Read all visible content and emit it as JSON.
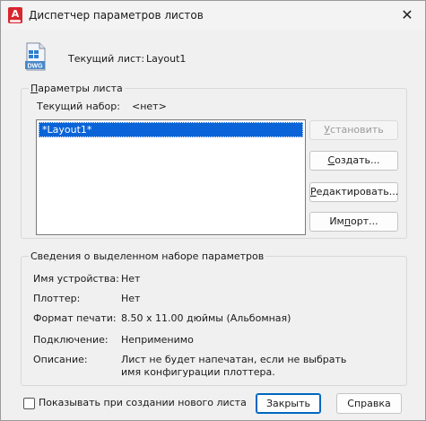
{
  "window": {
    "title": "Диспетчер параметров листов",
    "app_icon": "autocad-icon",
    "app_icon_letter": "A",
    "close_glyph": "✕"
  },
  "current_sheet": {
    "icon": "dwg-file-icon",
    "icon_text": "DWG",
    "label": "Текущий лист:",
    "value": "Layout1"
  },
  "sheet_params": {
    "legend_u": "П",
    "legend_rest": "араметры листа",
    "current_set_label": "Текущий набор:",
    "current_set_value": "<нет>",
    "list_items": [
      "*Layout1*"
    ],
    "buttons": {
      "set_u": "У",
      "set_rest": "становить",
      "create_u": "С",
      "create_rest": "оздать...",
      "edit_u": "Р",
      "edit_rest": "едактировать...",
      "import_pre": "Им",
      "import_u": "п",
      "import_rest": "орт..."
    }
  },
  "selected_info": {
    "legend": "Сведения о выделенном наборе параметров",
    "rows": [
      {
        "label": "Имя устройства:",
        "value": "Нет"
      },
      {
        "label": "Плоттер:",
        "value": "Нет"
      },
      {
        "label": "Формат печати:",
        "value": "8.50 x 11.00 дюймы (Альбомная)"
      },
      {
        "label": "Подключение:",
        "value": "Неприменимо"
      },
      {
        "label": "Описание:",
        "value": "Лист не будет напечатан, если не выбрать имя конфигурации плоттера."
      }
    ]
  },
  "footer": {
    "checkbox_label": "Показывать при создании нового листа",
    "checkbox_checked": false,
    "close_label": "Закрыть",
    "help_label": "Справка"
  },
  "colors": {
    "accent": "#0067c0",
    "selection": "#0a64d7",
    "app_icon_red": "#d8262e"
  }
}
